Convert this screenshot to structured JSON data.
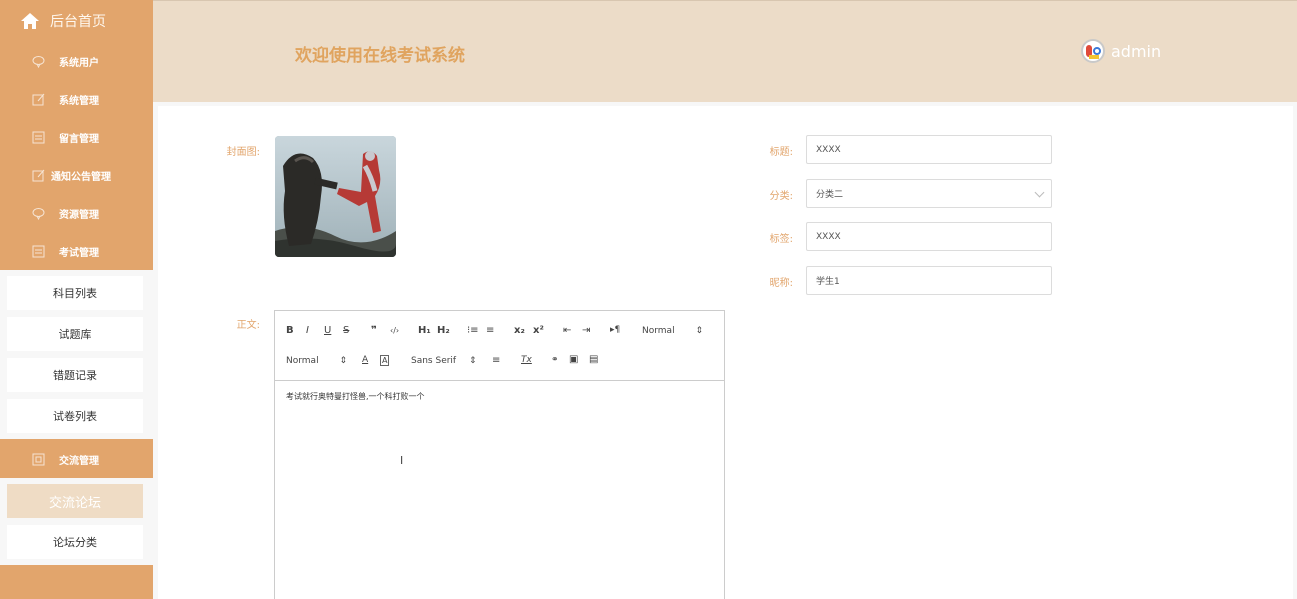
{
  "sidebar": {
    "home_label": "后台首页",
    "menus": [
      {
        "label": "系统用户",
        "icon": "comment-icon"
      },
      {
        "label": "系统管理",
        "icon": "edit-icon"
      },
      {
        "label": "留言管理",
        "icon": "list-icon"
      },
      {
        "label": "通知公告管理",
        "icon": "edit-icon"
      },
      {
        "label": "资源管理",
        "icon": "comment-icon"
      },
      {
        "label": "考试管理",
        "icon": "list-icon"
      },
      {
        "label": "交流管理",
        "icon": "box-icon"
      }
    ],
    "exam_sub": [
      "科目列表",
      "试题库",
      "错题记录",
      "试卷列表"
    ],
    "forum_sub": [
      "交流论坛",
      "论坛分类"
    ]
  },
  "header": {
    "title": "欢迎使用在线考试系统",
    "username": "admin"
  },
  "form": {
    "cover_label": "封面图:",
    "title_label": "标题:",
    "title_value": "XXXX",
    "category_label": "分类:",
    "category_value": "分类二",
    "tag_label": "标签:",
    "tag_value": "XXXX",
    "nickname_label": "昵称:",
    "nickname_value": "学生1",
    "body_label": "正文:",
    "body_content": "考试就行奥特曼打怪兽,一个科打败一个"
  },
  "toolbar": {
    "bold": "B",
    "italic": "I",
    "underline": "U",
    "strike": "S",
    "blockquote": "❞",
    "code": "‹/›",
    "h1": "H₁",
    "h2": "H₂",
    "ordered_list": "⁝≡",
    "bullet_list": "≡",
    "subscript": "x₂",
    "superscript": "x²",
    "outdent": "⇤",
    "indent": "⇥",
    "direction": "▸¶",
    "header_pick": "Normal",
    "size_pick": "Normal",
    "font_pick": "Sans Serif",
    "color": "A",
    "background": "A",
    "align": "≡",
    "clean": "Tx",
    "link": "🔗",
    "image": "▣",
    "video": "▤"
  },
  "colors": {
    "sidebar": "#e2a56c",
    "header": "#ecdcc8",
    "accent": "#e0a45f"
  }
}
